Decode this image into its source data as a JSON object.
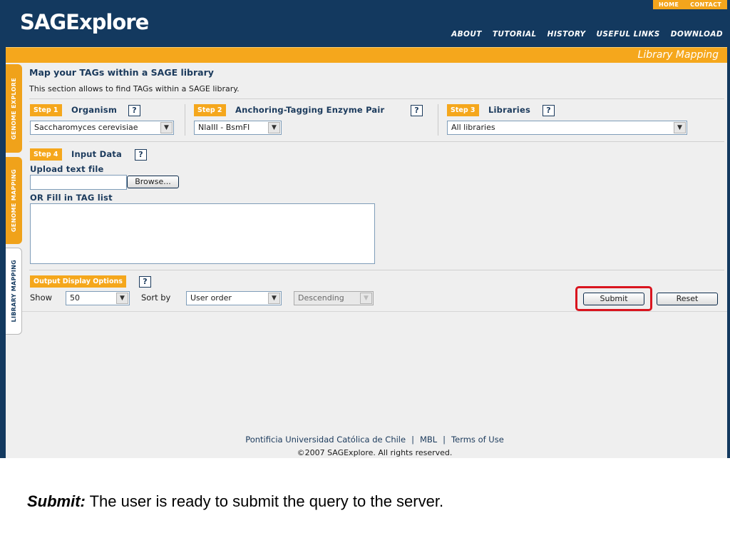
{
  "app": {
    "logo": "SAGExplore"
  },
  "top_links": [
    "HOME",
    "CONTACT"
  ],
  "main_nav": [
    "ABOUT",
    "TUTORIAL",
    "HISTORY",
    "USEFUL LINKS",
    "DOWNLOAD"
  ],
  "section_title": "Library Mapping",
  "side_tabs": [
    "GENOME EXPLORE",
    "GENOME MAPPING",
    "LIBRARY MAPPING"
  ],
  "page": {
    "title": "Map your TAGs within a SAGE library",
    "description": "This section allows to find TAGs within a SAGE library."
  },
  "steps": [
    {
      "badge": "Step 1",
      "label": "Organism",
      "help": "?",
      "selected": "Saccharomyces cerevisiae"
    },
    {
      "badge": "Step 2",
      "label": "Anchoring-Tagging Enzyme Pair",
      "help": "?",
      "selected": "NlaIII - BsmFI"
    },
    {
      "badge": "Step 3",
      "label": "Libraries",
      "help": "?",
      "selected": "All libraries"
    }
  ],
  "input": {
    "badge": "Step 4",
    "label": "Input Data",
    "help": "?",
    "upload_label": "Upload text file",
    "browse_button": "Browse...",
    "fill_label": "OR Fill in TAG list"
  },
  "output_options": {
    "badge": "Output Display Options",
    "help": "?",
    "show_label": "Show",
    "show_value": "50",
    "sort_label": "Sort by",
    "sort_value": "User order",
    "order_value": "Descending"
  },
  "buttons": {
    "submit": "Submit",
    "reset": "Reset"
  },
  "footer": {
    "links": [
      "Pontificia Universidad Católica de Chile",
      "MBL",
      "Terms of Use"
    ],
    "separator": "|",
    "copyright": "©2007 SAGExplore. All rights reserved."
  },
  "caption": {
    "term": "Submit:",
    "text": " The user is ready to submit the query to the server."
  },
  "colors": {
    "navy": "#13395f",
    "orange": "#f5a71c",
    "highlight": "#d9141e"
  }
}
